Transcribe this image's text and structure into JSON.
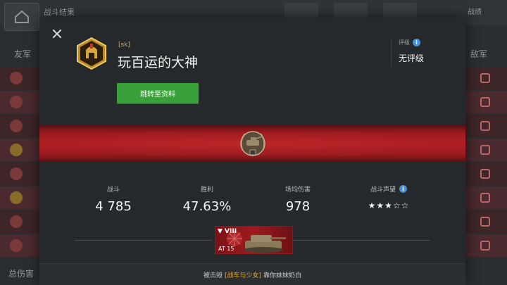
{
  "background": {
    "title": "战斗结果",
    "left_team_label": "友军",
    "right_team_label": "敌军",
    "bottom_label": "总伤害",
    "right_top_label": "战绩"
  },
  "player": {
    "clan_tag": "[sk]",
    "name": "玩百运的大神",
    "profile_button": "跳转至资料",
    "emblem_icon": "spartan-helmet-icon"
  },
  "rating": {
    "label": "评级",
    "value": "无评级"
  },
  "stats": [
    {
      "label": "战斗",
      "value": "4 785"
    },
    {
      "label": "胜利",
      "value": "47.63%"
    },
    {
      "label": "场均伤害",
      "value": "978"
    },
    {
      "label": "战斗声望",
      "value": "★★★☆☆",
      "rating_stars": 3,
      "rating_max": 5
    }
  ],
  "vehicle": {
    "tier": "▼ VIII",
    "name": "AT 15",
    "nation_icon": "japan-flag-icon"
  },
  "footer": {
    "prefix": "被击毁",
    "bracket_text": "[战车与少女]",
    "suffix": "靠你妹妹奶白"
  },
  "colors": {
    "accent_green": "#3aa03a",
    "banner_red": "#b21f23",
    "clan_gold": "#e0a93a",
    "info_blue": "#4a90d9"
  }
}
